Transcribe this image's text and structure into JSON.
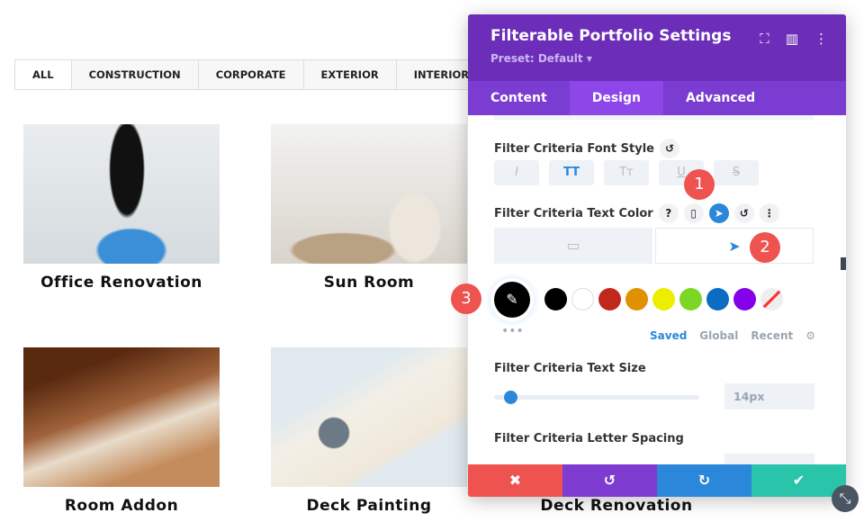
{
  "filters": [
    "ALL",
    "CONSTRUCTION",
    "CORPORATE",
    "EXTERIOR",
    "INTERIOR"
  ],
  "portfolio": [
    "Office Renovation",
    "Sun Room",
    "Room Addon",
    "Deck Painting",
    "Deck Renovation"
  ],
  "panel": {
    "title": "Filterable Portfolio Settings",
    "preset": "Preset: Default ▾",
    "tabs": [
      "Content",
      "Design",
      "Advanced"
    ],
    "font_style_label": "Filter Criteria Font Style",
    "font_style_buttons": [
      "I",
      "TT",
      "Tт",
      "U",
      "S"
    ],
    "text_color_label": "Filter Criteria Text Color",
    "swatches": [
      "#000000",
      "#ffffff",
      "#c0281c",
      "#e09000",
      "#eded00",
      "#7cd624",
      "#0c6cc4",
      "#8300e9"
    ],
    "palette_tabs": [
      "Saved",
      "Global",
      "Recent"
    ],
    "text_size_label": "Filter Criteria Text Size",
    "text_size_value": "14px",
    "text_size_fraction": 0.05,
    "letter_spacing_label": "Filter Criteria Letter Spacing"
  },
  "badges": [
    "1",
    "2",
    "3"
  ],
  "colors": {
    "header": "#6c2eb9",
    "accent": "#2b87da",
    "cancel": "#ef5350",
    "undo": "#7e3bd0",
    "redo": "#2b87da",
    "save": "#29c4a9"
  }
}
